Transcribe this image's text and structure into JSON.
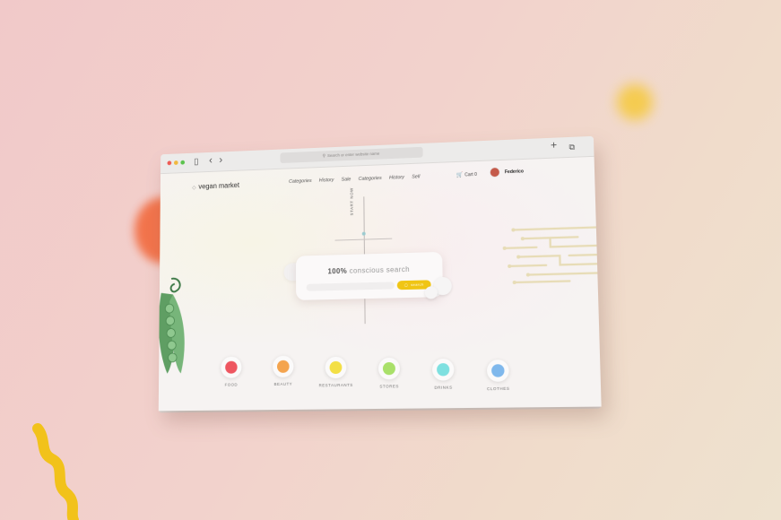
{
  "browser": {
    "url_placeholder": "Search or enter website name",
    "back_glyph": "‹",
    "forward_glyph": "›",
    "sidebar_glyph": "▯",
    "new_tab_glyph": "+",
    "tabs_glyph": "⧉"
  },
  "site": {
    "logo": "vegan market",
    "logo_mark": "◇",
    "nav": [
      "Categories",
      "History",
      "Sale",
      "Categories",
      "History",
      "Sell"
    ],
    "cart_label": "Cart 0",
    "cart_glyph": "🛒",
    "user_name": "Federico"
  },
  "hero": {
    "vertical_label": "START NOW",
    "search_bold": "100%",
    "search_rest": " conscious search",
    "search_input_placeholder": "",
    "search_button": "search",
    "search_icon": "◯"
  },
  "categories": [
    {
      "label": "FOOD",
      "color": "#ee5660"
    },
    {
      "label": "BEAUTY",
      "color": "#f4a44e"
    },
    {
      "label": "RESTAURANTS",
      "color": "#f3df45"
    },
    {
      "label": "STORES",
      "color": "#a9e06a"
    },
    {
      "label": "DRINKS",
      "color": "#7ee0e0"
    },
    {
      "label": "CLOTHES",
      "color": "#7fb8ec"
    }
  ],
  "colors": {
    "accent": "#f0c514",
    "background": "#f1c9c9"
  }
}
